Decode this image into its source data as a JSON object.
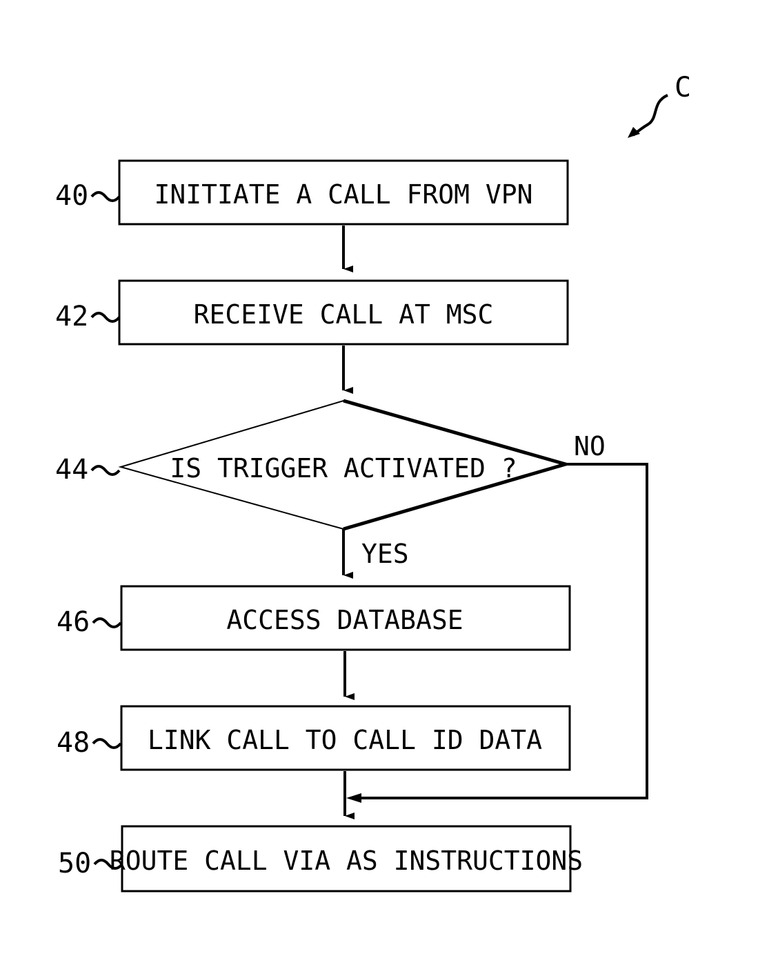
{
  "figure_ref": "C",
  "steps": [
    {
      "id": "40",
      "text": "INITIATE A CALL FROM VPN"
    },
    {
      "id": "42",
      "text": "RECEIVE CALL AT MSC"
    },
    {
      "id": "44",
      "text": "IS TRIGGER ACTIVATED ?"
    },
    {
      "id": "46",
      "text": "ACCESS DATABASE"
    },
    {
      "id": "48",
      "text": "LINK CALL TO CALL ID DATA"
    },
    {
      "id": "50",
      "text": "ROUTE CALL VIA AS INSTRUCTIONS"
    }
  ],
  "branches": {
    "no": "NO",
    "yes": "YES"
  }
}
